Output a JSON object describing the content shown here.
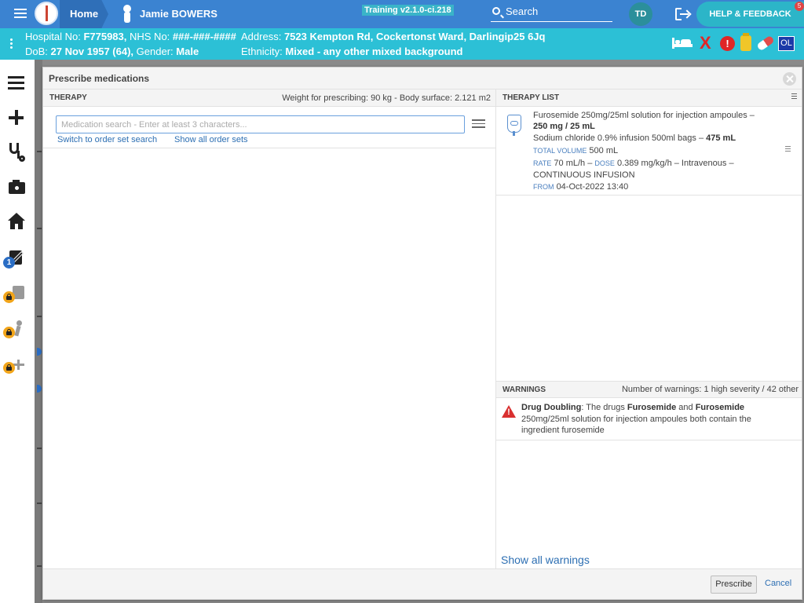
{
  "topbar": {
    "home_label": "Home",
    "patient_name": "Jamie BOWERS",
    "version": "Training v2.1.0-ci.218",
    "search_label": "Search",
    "user_initials": "TD",
    "help_label": "HELP & FEEDBACK",
    "notification_count": "5",
    "bar_color": "#3b83d1"
  },
  "banner": {
    "hospital_no_label": "Hospital No:",
    "hospital_no": "F775983,",
    "nhs_no_label": "NHS No:",
    "nhs_no": "###-###-####",
    "address_label": "Address:",
    "address": "7523 Kempton Rd, Cockertonst Ward, Darlingip25 6Jq",
    "dob_label": "DoB:",
    "dob": "27 Nov 1957 (64),",
    "gender_label": "Gender:",
    "gender": "Male",
    "ethnicity_label": "Ethnicity:",
    "ethnicity": "Mixed - any other mixed background",
    "icons": [
      "bed-icon",
      "x-icon",
      "alert-icon",
      "bottle-icon",
      "pill-icon",
      "ol-icon"
    ],
    "ol_label": "OL",
    "alert_symbol": "!",
    "x_symbol": "X",
    "bar_color": "#2cc0d6"
  },
  "sidebar": {
    "items": [
      {
        "icon": "list-icon"
      },
      {
        "icon": "plus-icon"
      },
      {
        "icon": "stethoscope-icon"
      },
      {
        "icon": "camera-icon"
      },
      {
        "icon": "home-icon"
      },
      {
        "icon": "edit-document-icon",
        "badge": "1"
      },
      {
        "icon": "clipboard-icon",
        "locked": true
      },
      {
        "icon": "walking-person-icon",
        "locked": true
      },
      {
        "icon": "add-icon",
        "locked": true
      }
    ]
  },
  "modal": {
    "title": "Prescribe medications",
    "therapy": {
      "header": "THERAPY",
      "weight_info": "Weight for prescribing: 90 kg - Body surface: 2.121 m2",
      "search_placeholder": "Medication search - Enter at least 3 characters...",
      "switch_link": "Switch to order set search",
      "show_all_link": "Show all order sets"
    },
    "therapy_list": {
      "header": "THERAPY LIST",
      "item": {
        "line1": "Furosemide 250mg/25ml solution for injection ampoules –",
        "line2": "250 mg / 25 mL",
        "line3_text": "Sodium chloride 0.9% infusion 500ml bags –",
        "line3_bold": "475 mL",
        "total_volume_label": "TOTAL VOLUME",
        "total_volume": "500 mL",
        "rate_label": "RATE",
        "rate": "70 mL/h –",
        "dose_label": "DOSE",
        "dose": "0.389 mg/kg/h – Intravenous –",
        "infusion": "CONTINUOUS INFUSION",
        "from_label": "FROM",
        "from": "04-Oct-2022 13:40"
      }
    },
    "warnings": {
      "header": "WARNINGS",
      "count": "Number of warnings: 1 high severity / 42 other",
      "item": {
        "label": "Drug Doubling",
        "text1": ": The drugs ",
        "drug1": "Furosemide",
        "and": " and ",
        "drug2": "Furosemide",
        "line2": "250mg/25ml solution for injection ampoules both contain the",
        "line3": "ingredient furosemide"
      },
      "show_all": "Show all warnings"
    },
    "footer": {
      "prescribe": "Prescribe",
      "cancel": "Cancel"
    }
  }
}
